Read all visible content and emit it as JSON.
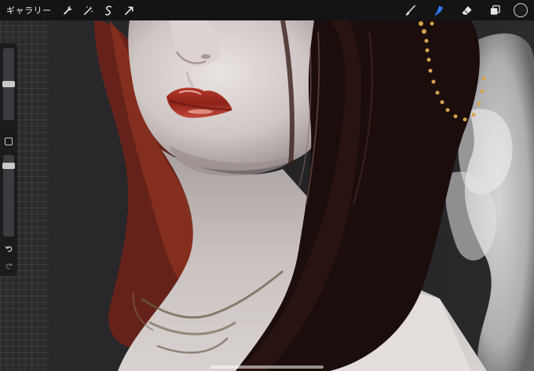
{
  "toolbar": {
    "gallery_label": "ギャラリー",
    "left_tools": [
      "wrench-icon",
      "magic-wand-icon",
      "selection-icon",
      "transform-arrow-icon"
    ],
    "right_tools": [
      "brush-icon",
      "smudge-icon",
      "eraser-icon",
      "layers-icon"
    ],
    "active_tool": "smudge",
    "accent_color": "#2f7bff",
    "current_color": "#1b1b1b"
  },
  "sidebar": {
    "brush_size_level": 0.5,
    "opacity_level": 0.1
  }
}
